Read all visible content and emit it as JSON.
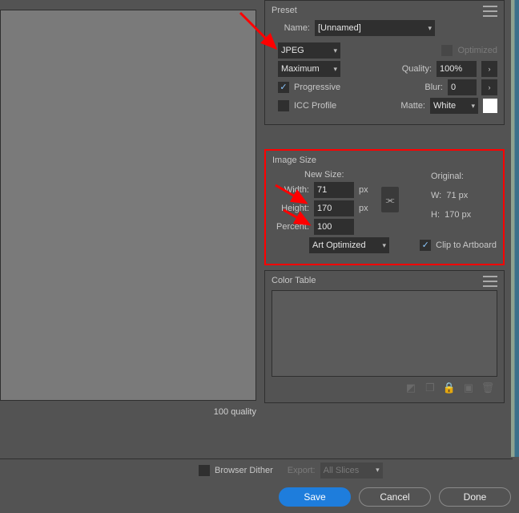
{
  "preview": {
    "quality_readout": "100 quality"
  },
  "preset": {
    "title": "Preset",
    "name_label": "Name:",
    "name_value": "[Unnamed]",
    "format": "JPEG",
    "optimized_label": "Optimized",
    "optimized_checked": false,
    "quality_preset": "Maximum",
    "quality_label": "Quality:",
    "quality_value": "100%",
    "progressive_label": "Progressive",
    "progressive_checked": true,
    "blur_label": "Blur:",
    "blur_value": "0",
    "icc_label": "ICC Profile",
    "icc_checked": false,
    "matte_label": "Matte:",
    "matte_value": "White"
  },
  "image_size": {
    "title": "Image Size",
    "new_size_label": "New Size:",
    "width_label": "Width:",
    "width_value": "71",
    "height_label": "Height:",
    "height_value": "170",
    "unit": "px",
    "percent_label": "Percent:",
    "percent_value": "100",
    "optimize_mode": "Art Optimized",
    "clip_label": "Clip to Artboard",
    "clip_checked": true,
    "original": {
      "title": "Original:",
      "w_label": "W:",
      "w_value": "71 px",
      "h_label": "H:",
      "h_value": "170 px"
    }
  },
  "color_table": {
    "title": "Color Table"
  },
  "footer": {
    "browser_dither_label": "Browser Dither",
    "browser_dither_checked": false,
    "export_label": "Export:",
    "export_value": "All Slices"
  },
  "buttons": {
    "save": "Save",
    "cancel": "Cancel",
    "done": "Done"
  }
}
